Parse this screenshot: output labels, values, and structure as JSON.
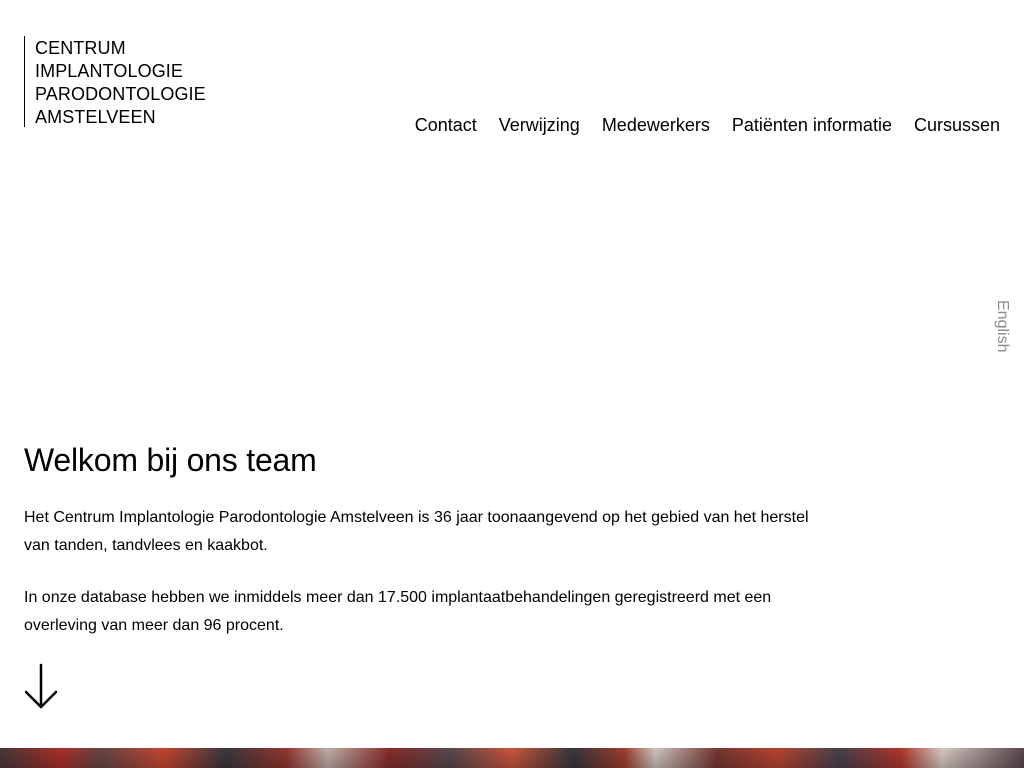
{
  "logo": {
    "lines": [
      "CENTRUM",
      "IMPLANTOLOGIE",
      "PARODONTOLOGIE",
      "AMSTELVEEN"
    ]
  },
  "nav": {
    "items": [
      {
        "label": "Contact"
      },
      {
        "label": "Verwijzing"
      },
      {
        "label": "Medewerkers"
      },
      {
        "label": "Patiënten informatie"
      },
      {
        "label": "Cursussen"
      }
    ]
  },
  "language": {
    "label": "English"
  },
  "main": {
    "title": "Welkom bij ons team",
    "paragraphs": [
      "Het Centrum Implantologie Parodontologie Amstelveen is 36 jaar toonaangevend op het gebied van het herstel van tanden, tandvlees en kaakbot.",
      "In onze database hebben we inmiddels meer dan 17.500 implantaatbehandelingen geregistreerd met een overleving van meer dan 96 procent."
    ],
    "scroll_icon": "arrow-down-icon"
  },
  "colors": {
    "text": "#000000",
    "language_link": "#8a8a8a",
    "background": "#ffffff"
  }
}
